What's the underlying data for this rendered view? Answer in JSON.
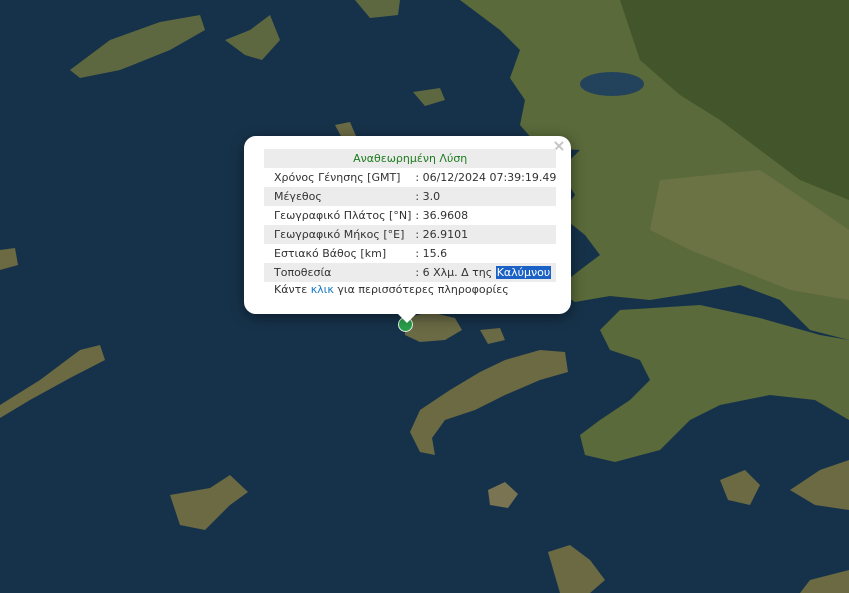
{
  "map": {
    "water_color": "#16324a",
    "land_color": "#5a6a3a",
    "land_dark_color": "#3d5028",
    "land_bright_color": "#7a7a4e",
    "lake_color": "#23435c"
  },
  "popup": {
    "close_symbol": "×",
    "title": "Αναθεωρημένη Λύση",
    "rows": [
      {
        "label": "Χρόνος Γένησης [GMT]",
        "value": ": 06/12/2024 07:39:19.49"
      },
      {
        "label": "Μέγεθος",
        "value": ": 3.0"
      },
      {
        "label": "Γεωγραφικό Πλάτος [°N]",
        "value": ": 36.9608"
      },
      {
        "label": "Γεωγραφικό Μήκος [°E]",
        "value": ": 26.9101"
      },
      {
        "label": "Εστιακό Βάθος [km]",
        "value": ": 15.6"
      }
    ],
    "location": {
      "label": "Τοποθεσία",
      "value_prefix": ": 6 Χλμ. Δ της",
      "value_highlight": "Καλύμνου"
    },
    "more_info": {
      "before": "Κάντε",
      "link": "κλικ",
      "after": "για περισσότερες πληροφορίες"
    }
  },
  "marker": {
    "color": "#2aa04a"
  }
}
